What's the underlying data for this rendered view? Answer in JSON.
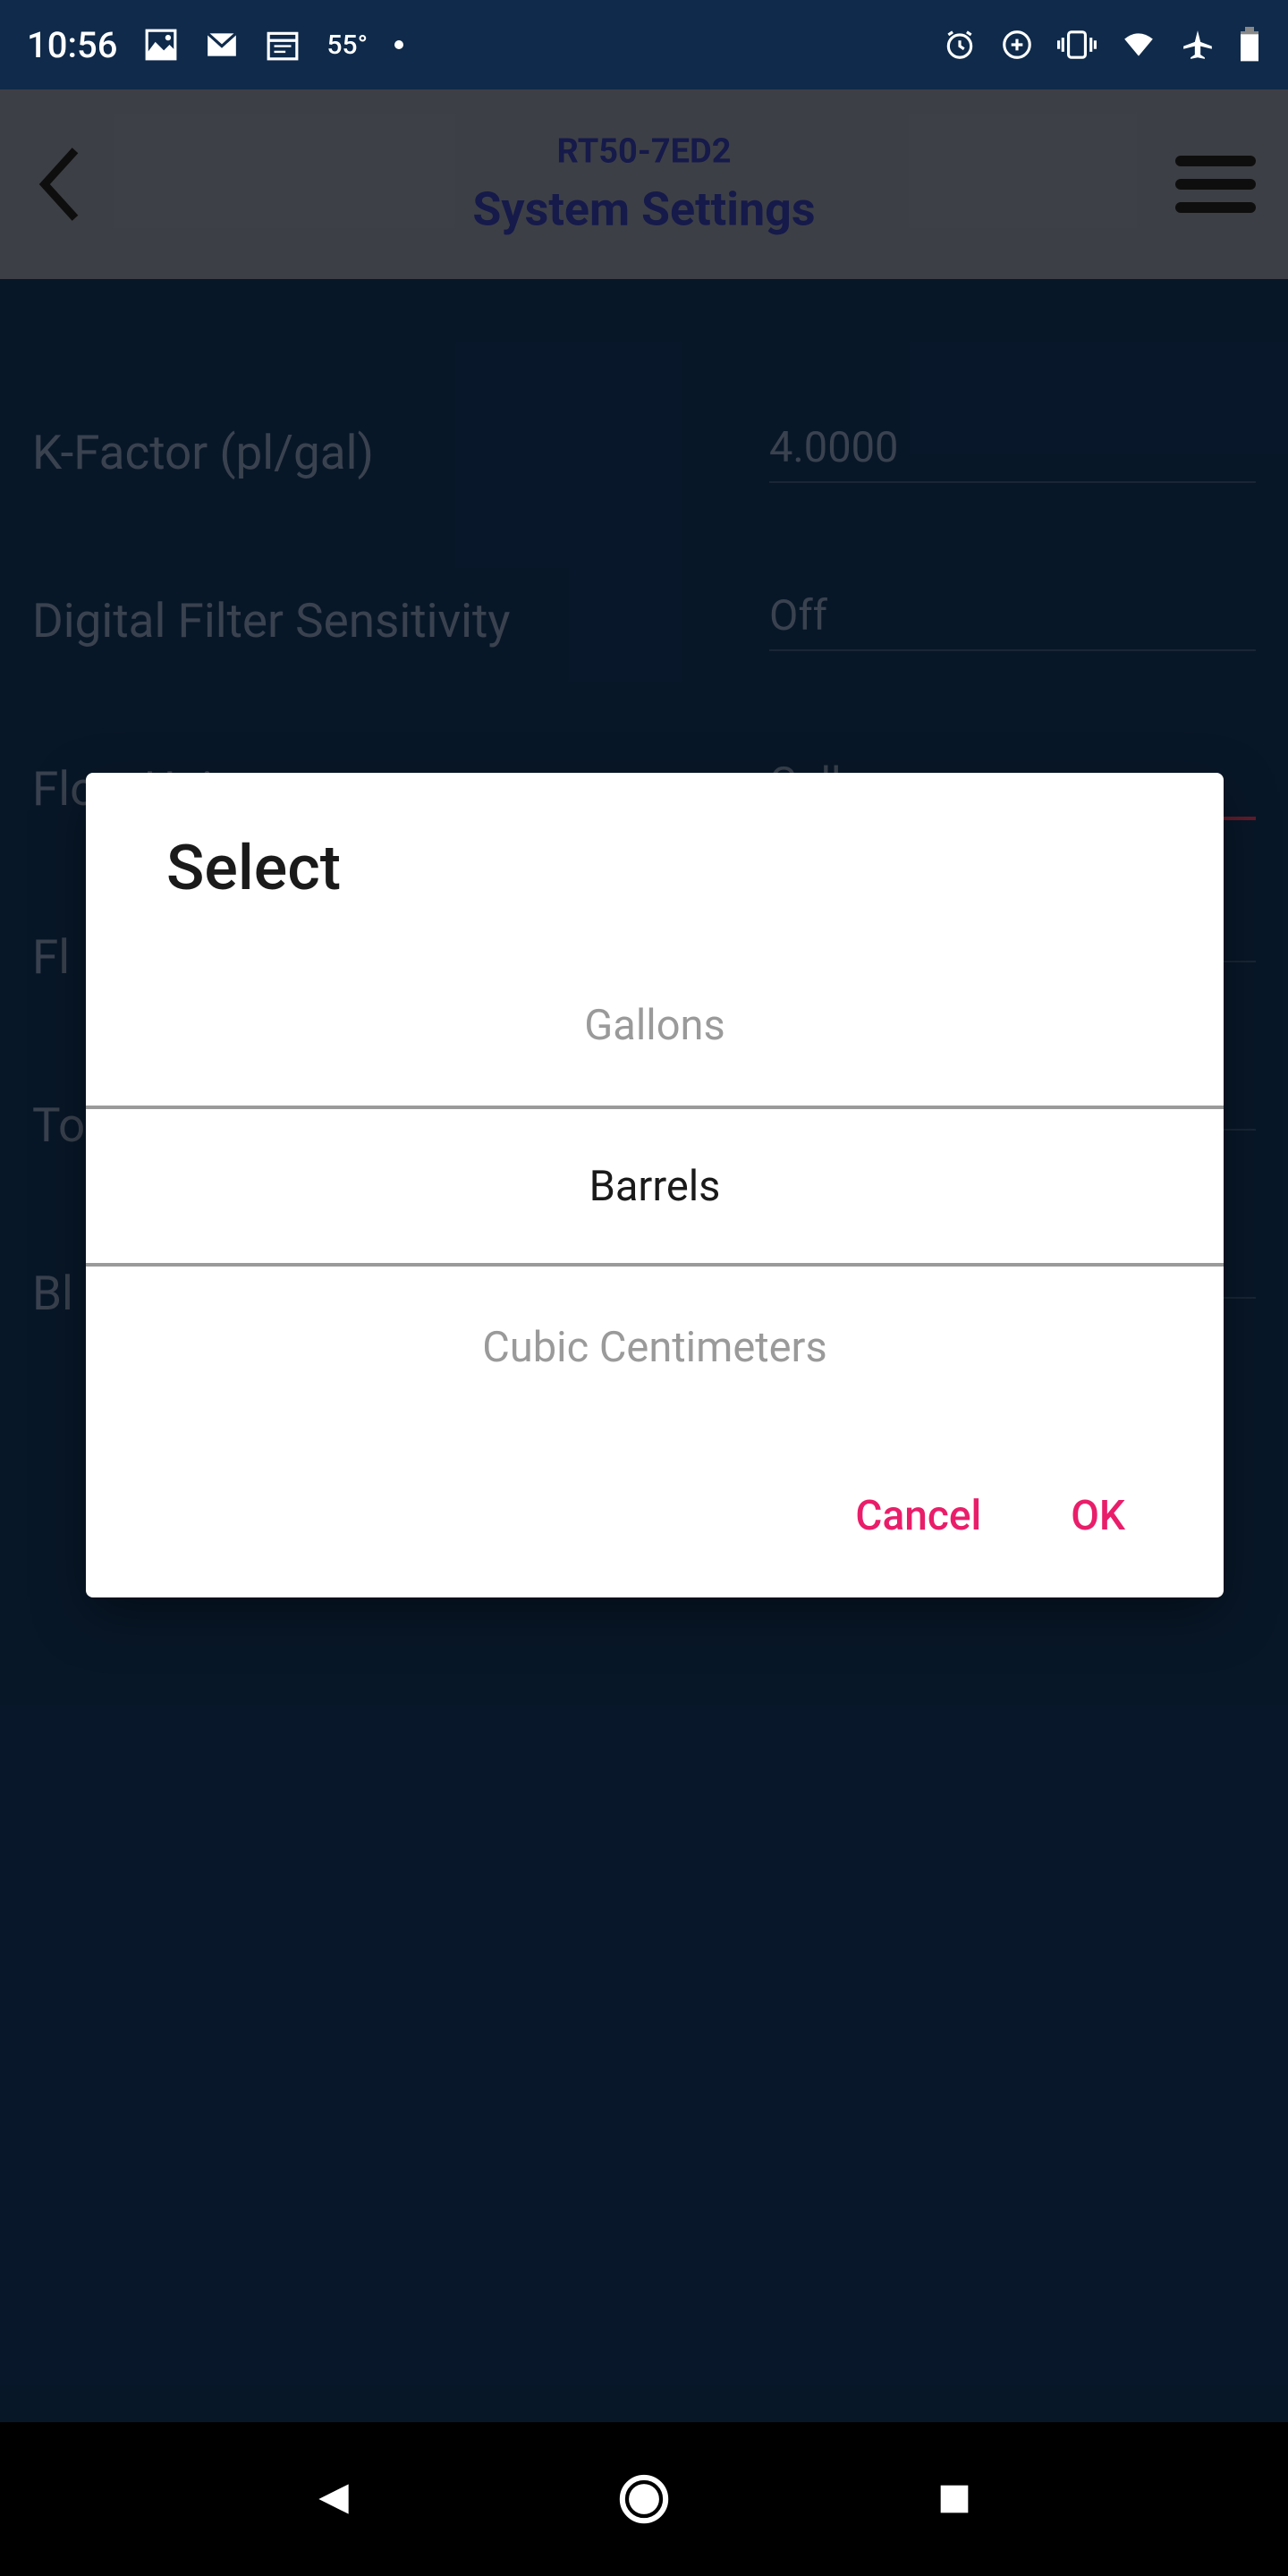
{
  "status": {
    "time": "10:56",
    "temp": "55°"
  },
  "header": {
    "device_id": "RT50-7ED2",
    "title": "System Settings"
  },
  "settings": {
    "kfactor": {
      "label": "K-Factor (pl/gal)",
      "value": "4.0000"
    },
    "filter": {
      "label": "Digital Filter Sensitivity",
      "value": "Off"
    },
    "flow_units": {
      "label": "Flow Units",
      "value": "Gallons"
    },
    "row4": {
      "label": "Fl"
    },
    "row5": {
      "label": "To"
    },
    "row6": {
      "label": "Bl"
    }
  },
  "dialog": {
    "title": "Select",
    "option_prev": "Gallons",
    "option_selected": "Barrels",
    "option_next": "Cubic Centimeters",
    "cancel": "Cancel",
    "ok": "OK"
  }
}
